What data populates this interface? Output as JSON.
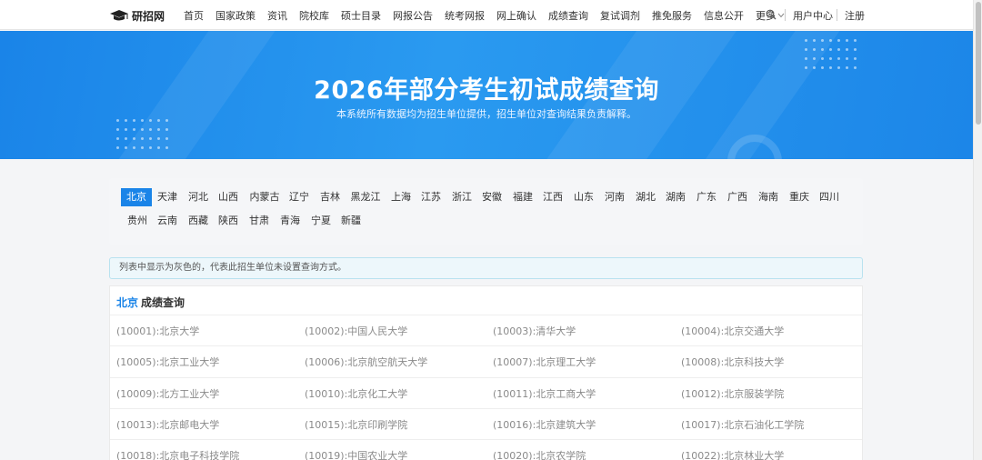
{
  "brand": {
    "name": "研招网",
    "icon": "graduation-cap-icon"
  },
  "nav": {
    "items": [
      "首页",
      "国家政策",
      "资讯",
      "院校库",
      "硕士目录",
      "网报公告",
      "统考网报",
      "网上确认",
      "成绩查询",
      "复试调剂",
      "推免服务",
      "信息公开"
    ],
    "more": "更多",
    "user_center": "用户中心",
    "register": "注册"
  },
  "banner": {
    "title": "2026年部分考生初试成绩查询",
    "subtitle": "本系统所有数据均为招生单位提供，招生单位对查询结果负责解释。"
  },
  "provinces": {
    "row1": [
      "北京",
      "天津",
      "河北",
      "山西",
      "内蒙古",
      "辽宁",
      "吉林",
      "黑龙江",
      "上海",
      "江苏",
      "浙江",
      "安徽",
      "福建",
      "江西",
      "山东",
      "河南",
      "湖北",
      "湖南",
      "广东",
      "广西",
      "海南",
      "重庆",
      "四川"
    ],
    "row2": [
      "贵州",
      "云南",
      "西藏",
      "陕西",
      "甘肃",
      "青海",
      "宁夏",
      "新疆"
    ],
    "active": "北京"
  },
  "notice": "列表中显示为灰色的，代表此招生单位未设置查询方式。",
  "results": {
    "province": "北京",
    "title": "成绩查询",
    "rows": [
      [
        "(10001):北京大学",
        "(10002):中国人民大学",
        "(10003):清华大学",
        "(10004):北京交通大学"
      ],
      [
        "(10005):北京工业大学",
        "(10006):北京航空航天大学",
        "(10007):北京理工大学",
        "(10008):北京科技大学"
      ],
      [
        "(10009):北方工业大学",
        "(10010):北京化工大学",
        "(10011):北京工商大学",
        "(10012):北京服装学院"
      ],
      [
        "(10013):北京邮电大学",
        "(10015):北京印刷学院",
        "(10016):北京建筑大学",
        "(10017):北京石油化工学院"
      ],
      [
        "(10018):北京电子科技学院",
        "(10019):中国农业大学",
        "(10020):北京农学院",
        "(10022):北京林业大学"
      ]
    ]
  },
  "colors": {
    "accent": "#1a84e8",
    "disabled_text": "#8a8a8a"
  }
}
